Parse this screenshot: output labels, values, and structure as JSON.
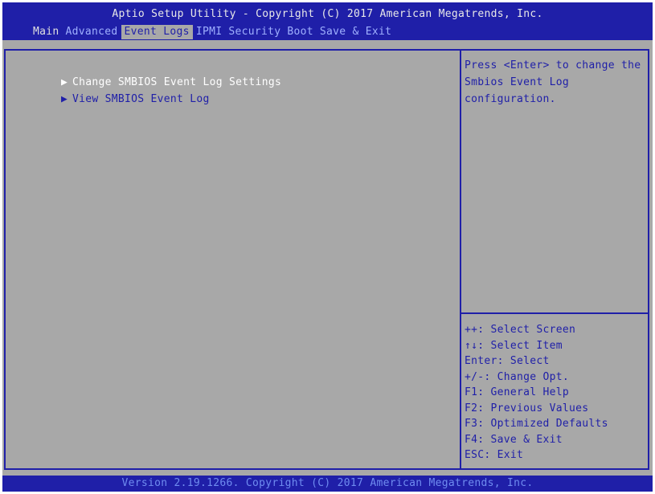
{
  "title_bar": {
    "title": "Aptio Setup Utility - Copyright (C) 2017 American Megatrends, Inc."
  },
  "menu": {
    "items": [
      {
        "label": "Main"
      },
      {
        "label": "Advanced"
      },
      {
        "label": "Event Logs"
      },
      {
        "label": "IPMI"
      },
      {
        "label": "Security"
      },
      {
        "label": "Boot"
      },
      {
        "label": "Save & Exit"
      }
    ],
    "active": "Event Logs"
  },
  "left_panel": {
    "items": [
      {
        "label": "Change SMBIOS Event Log Settings",
        "selected": true
      },
      {
        "label": "View SMBIOS Event Log",
        "selected": false
      }
    ],
    "arrow_icon": "triangle-right-icon"
  },
  "help_panel": {
    "description": "Press <Enter> to change the\nSmbios Event Log\nconfiguration.",
    "keys": [
      "++: Select Screen",
      "↑↓: Select Item",
      "Enter: Select",
      "+/-: Change Opt.",
      "F1: General Help",
      "F2: Previous Values",
      "F3: Optimized Defaults",
      "F4: Save & Exit",
      "ESC: Exit"
    ]
  },
  "footer": {
    "text": "Version 2.19.1266. Copyright (C) 2017 American Megatrends, Inc."
  },
  "colors": {
    "bios_blue": "#1f1fa8",
    "bios_gray": "#a8a8a8",
    "highlight_white": "#ffffff",
    "inactive_tab": "#9fb0ff",
    "footer_text": "#6f8cf0"
  }
}
